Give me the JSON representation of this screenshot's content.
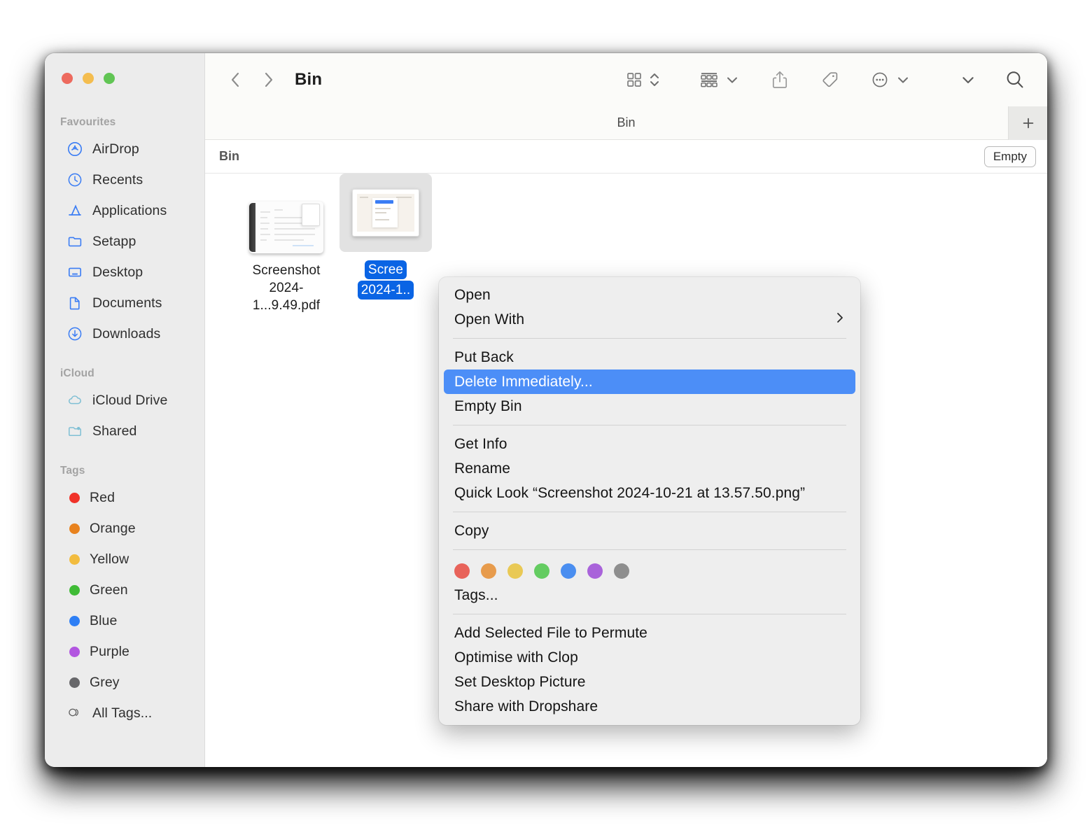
{
  "window": {
    "title": "Bin",
    "traffic_lights": [
      "close-red",
      "minimise-yellow",
      "zoom-green"
    ]
  },
  "toolbar": {
    "back_icon": "chevron-left-icon",
    "forward_icon": "chevron-right-icon",
    "title": "Bin",
    "icons": [
      {
        "name": "icon-view-icon",
        "label": "Icon View"
      },
      {
        "name": "view-sort-chevrons-icon",
        "label": "View Options"
      },
      {
        "name": "group-by-icon",
        "label": "Group"
      },
      {
        "name": "group-chevron-icon",
        "label": "Group menu"
      },
      {
        "name": "share-icon",
        "label": "Share"
      },
      {
        "name": "tag-icon",
        "label": "Tags"
      },
      {
        "name": "more-ellipsis-icon",
        "label": "More"
      },
      {
        "name": "more-chevron-icon",
        "label": "More menu"
      },
      {
        "name": "overflow-chevron-icon",
        "label": "Overflow"
      },
      {
        "name": "search-icon",
        "label": "Search"
      }
    ]
  },
  "tabbar": {
    "active_tab": "Bin",
    "add_tab_label": "+"
  },
  "pathbar": {
    "crumb": "Bin",
    "empty_button": "Empty"
  },
  "sidebar": {
    "sections": [
      {
        "title": "Favourites",
        "items": [
          {
            "label": "AirDrop",
            "icon": "airdrop-icon"
          },
          {
            "label": "Recents",
            "icon": "clock-icon"
          },
          {
            "label": "Applications",
            "icon": "applications-icon"
          },
          {
            "label": "Setapp",
            "icon": "folder-icon"
          },
          {
            "label": "Desktop",
            "icon": "desktop-icon"
          },
          {
            "label": "Documents",
            "icon": "document-icon"
          },
          {
            "label": "Downloads",
            "icon": "downloads-icon"
          }
        ]
      },
      {
        "title": "iCloud",
        "items": [
          {
            "label": "iCloud Drive",
            "icon": "cloud-icon"
          },
          {
            "label": "Shared",
            "icon": "shared-folder-icon"
          }
        ]
      },
      {
        "title": "Tags",
        "items": [
          {
            "label": "Red",
            "icon": "tag-dot-icon",
            "color": "#f03229"
          },
          {
            "label": "Orange",
            "icon": "tag-dot-icon",
            "color": "#e8821e"
          },
          {
            "label": "Yellow",
            "icon": "tag-dot-icon",
            "color": "#f2bc3f"
          },
          {
            "label": "Green",
            "icon": "tag-dot-icon",
            "color": "#3fbb36"
          },
          {
            "label": "Blue",
            "icon": "tag-dot-icon",
            "color": "#2e7ff5"
          },
          {
            "label": "Purple",
            "icon": "tag-dot-icon",
            "color": "#b256e0"
          },
          {
            "label": "Grey",
            "icon": "tag-dot-icon",
            "color": "#67676a"
          },
          {
            "label": "All Tags...",
            "icon": "all-tags-icon",
            "color": null
          }
        ]
      }
    ]
  },
  "files": [
    {
      "name_line1": "Screenshot",
      "name_line2": "2024-1...9.49.pdf",
      "kind": "pdf",
      "selected": false
    },
    {
      "name_line1": "Scree",
      "name_line2": "2024-1..",
      "kind": "png",
      "selected": true
    }
  ],
  "context_menu": {
    "groups": [
      {
        "items": [
          {
            "label": "Open",
            "submenu": false,
            "highlighted": false
          },
          {
            "label": "Open With",
            "submenu": true,
            "highlighted": false
          }
        ]
      },
      {
        "items": [
          {
            "label": "Put Back",
            "submenu": false,
            "highlighted": false
          },
          {
            "label": "Delete Immediately...",
            "submenu": false,
            "highlighted": true
          },
          {
            "label": "Empty Bin",
            "submenu": false,
            "highlighted": false
          }
        ]
      },
      {
        "items": [
          {
            "label": "Get Info",
            "submenu": false,
            "highlighted": false
          },
          {
            "label": "Rename",
            "submenu": false,
            "highlighted": false
          },
          {
            "label": "Quick Look “Screenshot 2024-10-21 at 13.57.50.png”",
            "submenu": false,
            "highlighted": false
          }
        ]
      },
      {
        "items": [
          {
            "label": "Copy",
            "submenu": false,
            "highlighted": false
          }
        ]
      },
      {
        "tag_swatches": [
          "#e8635a",
          "#e79b4c",
          "#e9c955",
          "#64cc61",
          "#4a8ef0",
          "#a963da",
          "#8e8e8e"
        ],
        "items": [
          {
            "label": "Tags...",
            "submenu": false,
            "highlighted": false
          }
        ]
      },
      {
        "items": [
          {
            "label": "Add Selected File to Permute",
            "submenu": false,
            "highlighted": false
          },
          {
            "label": "Optimise with Clop",
            "submenu": false,
            "highlighted": false
          },
          {
            "label": "Set Desktop Picture",
            "submenu": false,
            "highlighted": false
          },
          {
            "label": "Share with Dropshare",
            "submenu": false,
            "highlighted": false
          }
        ]
      }
    ]
  },
  "colors": {
    "highlight_blue": "#4c8ef7",
    "selection_blue": "#0a64e4",
    "sidebar_bg": "#ececec",
    "menu_bg": "#eeeeee"
  }
}
